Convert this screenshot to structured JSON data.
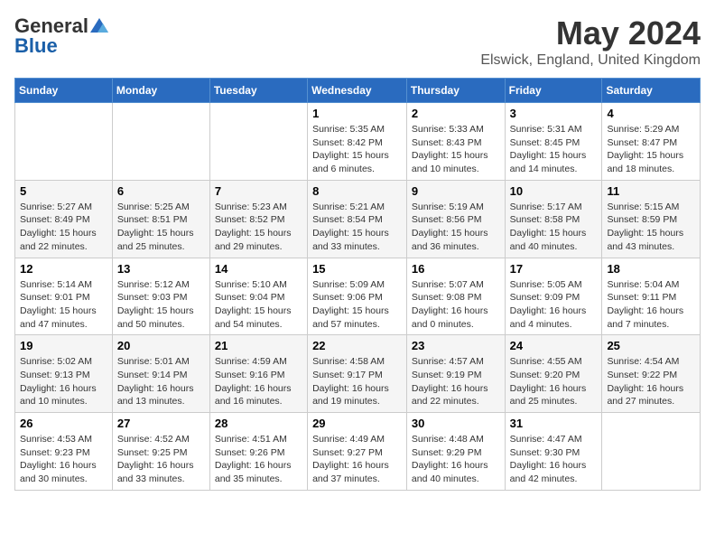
{
  "logo": {
    "general": "General",
    "blue": "Blue"
  },
  "title": "May 2024",
  "location": "Elswick, England, United Kingdom",
  "days_of_week": [
    "Sunday",
    "Monday",
    "Tuesday",
    "Wednesday",
    "Thursday",
    "Friday",
    "Saturday"
  ],
  "weeks": [
    [
      {
        "day": "",
        "info": ""
      },
      {
        "day": "",
        "info": ""
      },
      {
        "day": "",
        "info": ""
      },
      {
        "day": "1",
        "info": "Sunrise: 5:35 AM\nSunset: 8:42 PM\nDaylight: 15 hours\nand 6 minutes."
      },
      {
        "day": "2",
        "info": "Sunrise: 5:33 AM\nSunset: 8:43 PM\nDaylight: 15 hours\nand 10 minutes."
      },
      {
        "day": "3",
        "info": "Sunrise: 5:31 AM\nSunset: 8:45 PM\nDaylight: 15 hours\nand 14 minutes."
      },
      {
        "day": "4",
        "info": "Sunrise: 5:29 AM\nSunset: 8:47 PM\nDaylight: 15 hours\nand 18 minutes."
      }
    ],
    [
      {
        "day": "5",
        "info": "Sunrise: 5:27 AM\nSunset: 8:49 PM\nDaylight: 15 hours\nand 22 minutes."
      },
      {
        "day": "6",
        "info": "Sunrise: 5:25 AM\nSunset: 8:51 PM\nDaylight: 15 hours\nand 25 minutes."
      },
      {
        "day": "7",
        "info": "Sunrise: 5:23 AM\nSunset: 8:52 PM\nDaylight: 15 hours\nand 29 minutes."
      },
      {
        "day": "8",
        "info": "Sunrise: 5:21 AM\nSunset: 8:54 PM\nDaylight: 15 hours\nand 33 minutes."
      },
      {
        "day": "9",
        "info": "Sunrise: 5:19 AM\nSunset: 8:56 PM\nDaylight: 15 hours\nand 36 minutes."
      },
      {
        "day": "10",
        "info": "Sunrise: 5:17 AM\nSunset: 8:58 PM\nDaylight: 15 hours\nand 40 minutes."
      },
      {
        "day": "11",
        "info": "Sunrise: 5:15 AM\nSunset: 8:59 PM\nDaylight: 15 hours\nand 43 minutes."
      }
    ],
    [
      {
        "day": "12",
        "info": "Sunrise: 5:14 AM\nSunset: 9:01 PM\nDaylight: 15 hours\nand 47 minutes."
      },
      {
        "day": "13",
        "info": "Sunrise: 5:12 AM\nSunset: 9:03 PM\nDaylight: 15 hours\nand 50 minutes."
      },
      {
        "day": "14",
        "info": "Sunrise: 5:10 AM\nSunset: 9:04 PM\nDaylight: 15 hours\nand 54 minutes."
      },
      {
        "day": "15",
        "info": "Sunrise: 5:09 AM\nSunset: 9:06 PM\nDaylight: 15 hours\nand 57 minutes."
      },
      {
        "day": "16",
        "info": "Sunrise: 5:07 AM\nSunset: 9:08 PM\nDaylight: 16 hours\nand 0 minutes."
      },
      {
        "day": "17",
        "info": "Sunrise: 5:05 AM\nSunset: 9:09 PM\nDaylight: 16 hours\nand 4 minutes."
      },
      {
        "day": "18",
        "info": "Sunrise: 5:04 AM\nSunset: 9:11 PM\nDaylight: 16 hours\nand 7 minutes."
      }
    ],
    [
      {
        "day": "19",
        "info": "Sunrise: 5:02 AM\nSunset: 9:13 PM\nDaylight: 16 hours\nand 10 minutes."
      },
      {
        "day": "20",
        "info": "Sunrise: 5:01 AM\nSunset: 9:14 PM\nDaylight: 16 hours\nand 13 minutes."
      },
      {
        "day": "21",
        "info": "Sunrise: 4:59 AM\nSunset: 9:16 PM\nDaylight: 16 hours\nand 16 minutes."
      },
      {
        "day": "22",
        "info": "Sunrise: 4:58 AM\nSunset: 9:17 PM\nDaylight: 16 hours\nand 19 minutes."
      },
      {
        "day": "23",
        "info": "Sunrise: 4:57 AM\nSunset: 9:19 PM\nDaylight: 16 hours\nand 22 minutes."
      },
      {
        "day": "24",
        "info": "Sunrise: 4:55 AM\nSunset: 9:20 PM\nDaylight: 16 hours\nand 25 minutes."
      },
      {
        "day": "25",
        "info": "Sunrise: 4:54 AM\nSunset: 9:22 PM\nDaylight: 16 hours\nand 27 minutes."
      }
    ],
    [
      {
        "day": "26",
        "info": "Sunrise: 4:53 AM\nSunset: 9:23 PM\nDaylight: 16 hours\nand 30 minutes."
      },
      {
        "day": "27",
        "info": "Sunrise: 4:52 AM\nSunset: 9:25 PM\nDaylight: 16 hours\nand 33 minutes."
      },
      {
        "day": "28",
        "info": "Sunrise: 4:51 AM\nSunset: 9:26 PM\nDaylight: 16 hours\nand 35 minutes."
      },
      {
        "day": "29",
        "info": "Sunrise: 4:49 AM\nSunset: 9:27 PM\nDaylight: 16 hours\nand 37 minutes."
      },
      {
        "day": "30",
        "info": "Sunrise: 4:48 AM\nSunset: 9:29 PM\nDaylight: 16 hours\nand 40 minutes."
      },
      {
        "day": "31",
        "info": "Sunrise: 4:47 AM\nSunset: 9:30 PM\nDaylight: 16 hours\nand 42 minutes."
      },
      {
        "day": "",
        "info": ""
      }
    ]
  ]
}
